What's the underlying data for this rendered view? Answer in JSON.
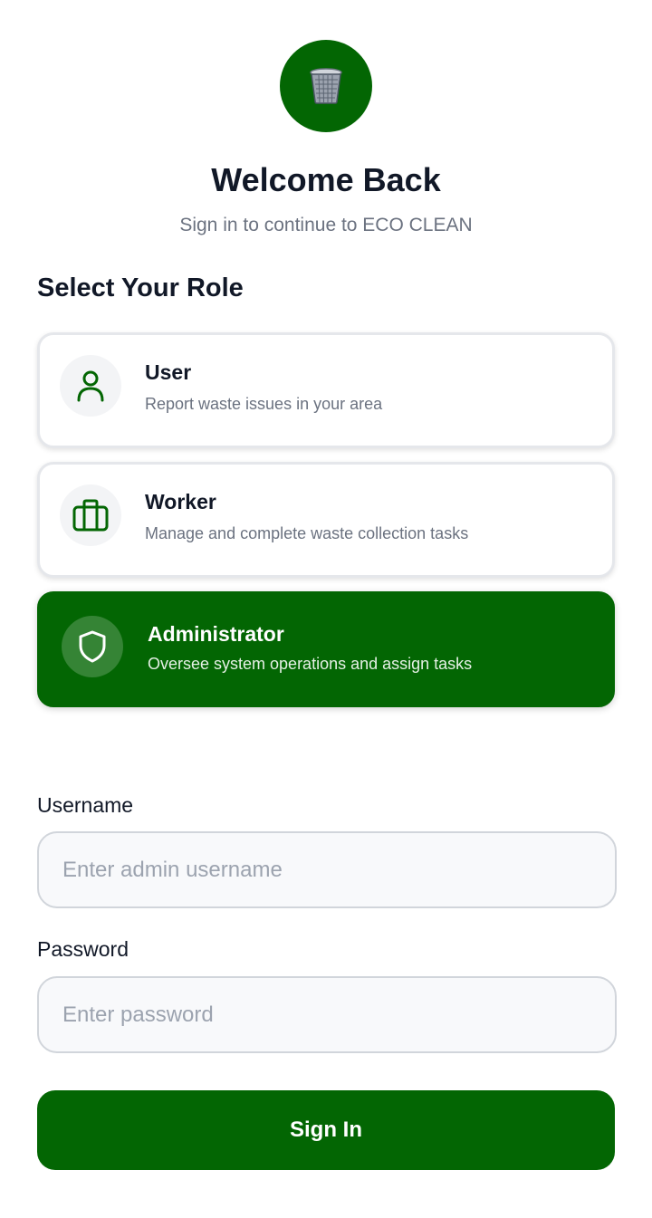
{
  "header": {
    "logo_icon": "trash-bin-icon",
    "title": "Welcome Back",
    "subtitle": "Sign in to continue to ECO CLEAN"
  },
  "roles": {
    "section_title": "Select Your Role",
    "selected": "Administrator",
    "items": [
      {
        "name": "User",
        "description": "Report waste issues in your area",
        "icon": "user-icon"
      },
      {
        "name": "Worker",
        "description": "Manage and complete waste collection tasks",
        "icon": "briefcase-icon"
      },
      {
        "name": "Administrator",
        "description": "Oversee system operations and assign tasks",
        "icon": "shield-icon"
      }
    ]
  },
  "form": {
    "username_label": "Username",
    "username_placeholder": "Enter admin username",
    "username_value": "",
    "password_label": "Password",
    "password_placeholder": "Enter password",
    "password_value": "",
    "submit_label": "Sign In"
  },
  "colors": {
    "primary": "#036603",
    "background": "#ffffff",
    "text": "#111827",
    "muted": "#6b7280"
  }
}
